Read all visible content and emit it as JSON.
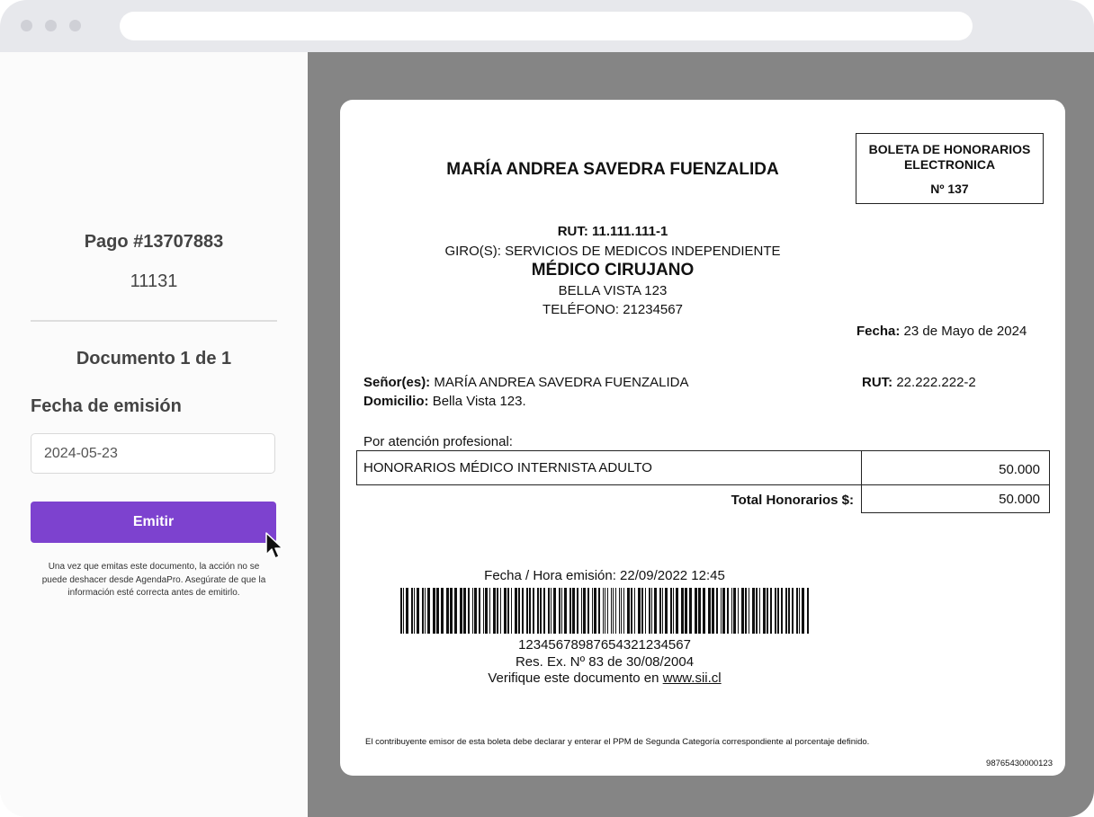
{
  "sidebar": {
    "pago_title": "Pago #13707883",
    "pago_number": "11131",
    "documento": "Documento 1 de 1",
    "fecha_label": "Fecha de emisión",
    "fecha_value": "2024-05-23",
    "emitir_label": "Emitir",
    "warning": "Una vez que emitas este documento, la acción no se puede deshacer desde AgendaPro. Asegúrate de que la información esté correcta antes de emitirlo."
  },
  "boleta": {
    "emisor_nombre": "MARÍA ANDREA SAVEDRA FUENZALIDA",
    "tipo_line1": "BOLETA DE HONORARIOS",
    "tipo_line2": "ELECTRONICA",
    "numero": "Nº 137",
    "rut_emisor": "RUT: 11.111.111-1",
    "giro": "GIRO(S): SERVICIOS DE MEDICOS INDEPENDIENTE",
    "profesion": "MÉDICO CIRUJANO",
    "direccion": "BELLA VISTA 123",
    "telefono": "TELÉFONO: 21234567",
    "fecha_label": "Fecha:",
    "fecha_value": "23 de Mayo de 2024",
    "senor_label": "Señor(es):",
    "senor_value": "MARÍA ANDREA SAVEDRA FUENZALIDA",
    "rut_label": "RUT:",
    "rut_value": "22.222.222-2",
    "domicilio_label": "Domicilio:",
    "domicilio_value": "Bella Vista 123.",
    "atencion": "Por atención profesional:",
    "item_desc": "HONORARIOS MÉDICO INTERNISTA ADULTO",
    "item_monto": "50.000",
    "total_label": "Total Honorarios $:",
    "total_monto": "50.000",
    "emision": "Fecha / Hora emisión: 22/09/2022  12:45",
    "barcode_number": "12345678987654321234567",
    "resolucion": "Res. Ex. Nº 83 de 30/08/2004",
    "verifique": "Verifique este documento en",
    "verifique_link": "www.sii.cl",
    "footer_note": "El contribuyente emisor de esta boleta debe declarar y enterar el PPM de Segunda Categoría correspondiente al porcentaje definido.",
    "footer_code": "98765430000123"
  },
  "colors": {
    "accent": "#7d42cf",
    "viewer_bg": "#858585",
    "titlebar": "#e7e8ec"
  },
  "icons": [
    "window-dot-icon",
    "mouse-pointer-icon",
    "barcode"
  ]
}
